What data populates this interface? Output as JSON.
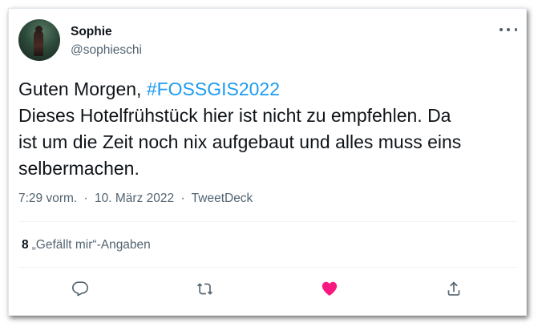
{
  "author": {
    "name": "Sophie",
    "handle": "@sophieschi"
  },
  "tweet": {
    "greeting": "Guten Morgen, ",
    "hashtag": "#FOSSGIS2022",
    "lines": [
      "Dieses Hotelfrühstück hier ist nicht zu empfehlen. Da",
      "ist um die Zeit noch nix aufgebaut und alles muss eins",
      "selbermachen."
    ]
  },
  "meta": {
    "time": "7:29 vorm.",
    "separator": "·",
    "date": "10. März 2022",
    "source": "TweetDeck"
  },
  "stats": {
    "like_count": "8",
    "like_label": "„Gefällt mir“-Angaben"
  },
  "actions": {
    "reply_icon": "reply-icon",
    "retweet_icon": "retweet-icon",
    "like_icon": "heart-icon",
    "share_icon": "share-icon"
  },
  "colors": {
    "hashtag": "#1d9bf0",
    "liked_heart": "#f91880",
    "secondary_text": "#536471",
    "primary_text": "#0f1419"
  }
}
